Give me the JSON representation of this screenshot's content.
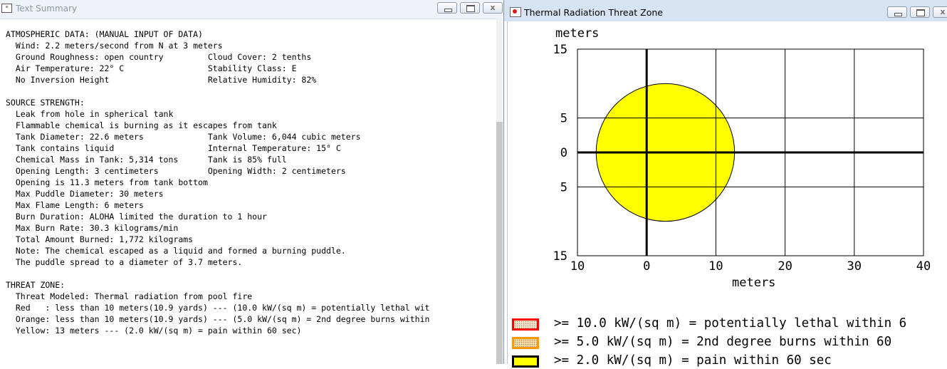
{
  "left_window": {
    "title": "Text Summary",
    "icon": "document-icon",
    "controls": {
      "minimize": "",
      "maximize": "",
      "close": "x"
    }
  },
  "summary_lines": [
    "ATMOSPHERIC DATA: (MANUAL INPUT OF DATA)",
    "  Wind: 2.2 meters/second from N at 3 meters",
    "  Ground Roughness: open country         Cloud Cover: 2 tenths",
    "  Air Temperature: 22° C                 Stability Class: E",
    "  No Inversion Height                    Relative Humidity: 82%",
    "",
    "SOURCE STRENGTH:",
    "  Leak from hole in spherical tank",
    "  Flammable chemical is burning as it escapes from tank",
    "  Tank Diameter: 22.6 meters             Tank Volume: 6,044 cubic meters",
    "  Tank contains liquid                   Internal Temperature: 15° C",
    "  Chemical Mass in Tank: 5,314 tons      Tank is 85% full",
    "  Opening Length: 3 centimeters          Opening Width: 2 centimeters",
    "  Opening is 11.3 meters from tank bottom",
    "  Max Puddle Diameter: 30 meters",
    "  Max Flame Length: 6 meters",
    "  Burn Duration: ALOHA limited the duration to 1 hour",
    "  Max Burn Rate: 30.3 kilograms/min",
    "  Total Amount Burned: 1,772 kilograms",
    "  Note: The chemical escaped as a liquid and formed a burning puddle.",
    "  The puddle spread to a diameter of 3.7 meters.",
    "",
    "THREAT ZONE:",
    "  Threat Modeled: Thermal radiation from pool fire",
    "  Red   : less than 10 meters(10.9 yards) --- (10.0 kW/(sq m) = potentially lethal wit",
    "  Orange: less than 10 meters(10.9 yards) --- (5.0 kW/(sq m) = 2nd degree burns within",
    "  Yellow: 13 meters --- (2.0 kW/(sq m) = pain within 60 sec)"
  ],
  "right_window": {
    "title": "Thermal Radiation Threat Zone",
    "icon": "aloha-app-icon",
    "controls": {
      "minimize": "",
      "maximize": "",
      "close": "x"
    }
  },
  "chart_data": {
    "type": "scatter",
    "ylabel": "meters",
    "xlabel": "meters",
    "x_ticks": [
      "10",
      "0",
      "10",
      "20",
      "30",
      "40"
    ],
    "y_ticks": [
      "15",
      "5",
      "0",
      "5",
      "15"
    ],
    "xlim": [
      -10,
      40
    ],
    "ylim": [
      -15,
      15
    ],
    "grid": true,
    "zones": [
      {
        "name": "Yellow",
        "shape": "circle",
        "center_x": 2.7,
        "center_y": 0,
        "radius": 10,
        "fill": "#ffff00"
      }
    ]
  },
  "legend": [
    {
      "label": ">= 10.0 kW/(sq m) = potentially lethal within 6",
      "border": "#ff0000",
      "fill": "#f4e2c8",
      "pattern": "dotted"
    },
    {
      "label": ">= 5.0 kW/(sq m) = 2nd degree burns within 60",
      "border": "#ff9900",
      "fill": "#f9d9a0",
      "pattern": "dotted"
    },
    {
      "label": ">= 2.0 kW/(sq m) = pain within 60 sec",
      "border": "#000000",
      "fill": "#ffff00",
      "pattern": "solid"
    }
  ]
}
